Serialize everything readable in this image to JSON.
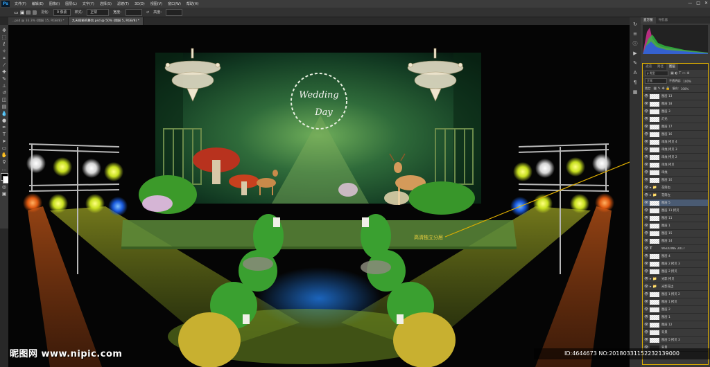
{
  "app": {
    "logo": "Ps"
  },
  "menubar": {
    "items": [
      "文件(F)",
      "编辑(E)",
      "图像(I)",
      "图层(L)",
      "文字(Y)",
      "选择(S)",
      "滤镜(T)",
      "3D(D)",
      "视图(V)",
      "窗口(W)",
      "帮助(H)"
    ]
  },
  "window_controls": {
    "minimize": "—",
    "maximize": "□",
    "close": "✕"
  },
  "options_bar": {
    "feather_label": "羽化:",
    "feather_value": "0 像素",
    "style_label": "样式:",
    "style_value": "正常",
    "width_label": "宽度:",
    "height_label": "高度:"
  },
  "tabs": [
    "...psd @ 33.3% (图层 15, RGB/8) *",
    "九天揽秘的舞台.psd @ 50% (图层 5, RGB/8) *"
  ],
  "panel_tabs": {
    "histogram": "直方图",
    "navigator": "导航器"
  },
  "layers_tabs": {
    "channels": "通道",
    "paths": "路径",
    "layers": "图层"
  },
  "layers_controls": {
    "kind": "ρ 类型",
    "blend": "正常",
    "opacity_label": "不透明度:",
    "opacity_value": "100%",
    "lock_label": "锁定:",
    "fill_label": "填充:",
    "fill_value": "100%"
  },
  "layers": [
    {
      "name": "图层 13",
      "kind": "layer"
    },
    {
      "name": "图层 18",
      "kind": "layer"
    },
    {
      "name": "图层 3",
      "kind": "layer"
    },
    {
      "name": "灯光",
      "kind": "layer"
    },
    {
      "name": "图层 17",
      "kind": "layer"
    },
    {
      "name": "图层 16",
      "kind": "layer"
    },
    {
      "name": "串烛 拷贝 4",
      "kind": "layer"
    },
    {
      "name": "串烛 拷贝 3",
      "kind": "layer"
    },
    {
      "name": "串烛 拷贝 2",
      "kind": "layer"
    },
    {
      "name": "串烛 拷贝",
      "kind": "layer"
    },
    {
      "name": "串烛",
      "kind": "layer"
    },
    {
      "name": "图层 10",
      "kind": "layer"
    },
    {
      "name": "花筒右",
      "kind": "folder"
    },
    {
      "name": "花筒左",
      "kind": "folder"
    },
    {
      "name": "图层 5",
      "kind": "layer",
      "selected": true
    },
    {
      "name": "图层 11 拷贝",
      "kind": "layer"
    },
    {
      "name": "图层 11",
      "kind": "layer"
    },
    {
      "name": "图层 1",
      "kind": "layer"
    },
    {
      "name": "图层 15",
      "kind": "layer"
    },
    {
      "name": "图层 14",
      "kind": "layer"
    },
    {
      "name": "WEDDING 2017",
      "kind": "text"
    },
    {
      "name": "图层 4",
      "kind": "layer"
    },
    {
      "name": "图层 2 拷贝 3",
      "kind": "layer"
    },
    {
      "name": "图层 2 拷贝",
      "kind": "layer"
    },
    {
      "name": "光影 拷贝",
      "kind": "folder"
    },
    {
      "name": "光影花边",
      "kind": "folder"
    },
    {
      "name": "图层 1 拷贝 2",
      "kind": "layer"
    },
    {
      "name": "图层 1 拷贝",
      "kind": "layer"
    },
    {
      "name": "图层 2",
      "kind": "layer"
    },
    {
      "name": "图层 1",
      "kind": "layer"
    },
    {
      "name": "图层 12",
      "kind": "layer"
    },
    {
      "name": "背景",
      "kind": "layer"
    },
    {
      "name": "图层 5 拷贝 3",
      "kind": "layer"
    },
    {
      "name": "背景",
      "kind": "background"
    }
  ],
  "canvas": {
    "annotation": "高清独立分层",
    "backdrop_script_1": "Wedding",
    "backdrop_script_2": "Day"
  },
  "watermark": {
    "site": "昵图网 www.nipic.com",
    "id": "ID:4644673 NO:20180331152232139000"
  }
}
